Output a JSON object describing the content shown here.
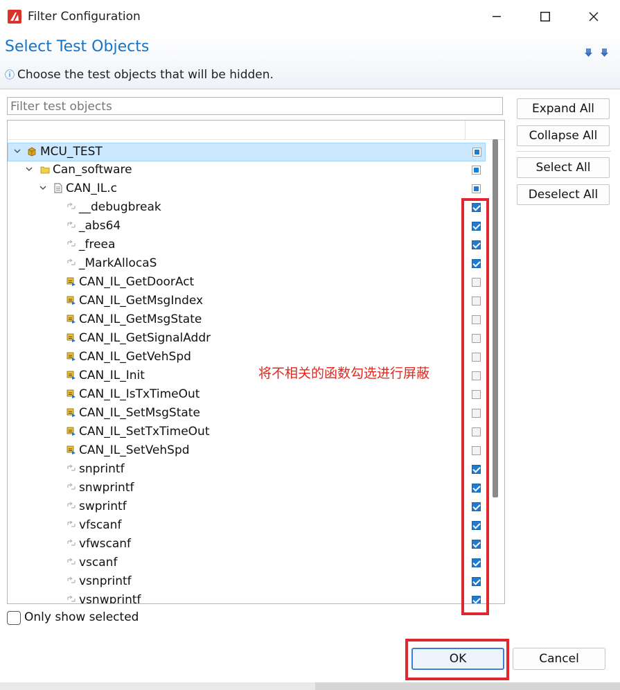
{
  "window": {
    "title": "Filter Configuration"
  },
  "header": {
    "title": "Select Test Objects",
    "info_symbol": "ⓘ",
    "description": "Choose the test objects that will be hidden."
  },
  "filter": {
    "placeholder": "Filter test objects"
  },
  "tree": [
    {
      "label": "MCU_TEST",
      "level": 0,
      "expandable": true,
      "icon": "project-icon",
      "state": "partial",
      "selected": true
    },
    {
      "label": "Can_software",
      "level": 1,
      "expandable": true,
      "icon": "folder-icon",
      "state": "partial"
    },
    {
      "label": "CAN_IL.c",
      "level": 2,
      "expandable": true,
      "icon": "file-icon",
      "state": "partial"
    },
    {
      "label": "__debugbreak",
      "level": 3,
      "icon": "external-function-icon",
      "state": "checked"
    },
    {
      "label": "_abs64",
      "level": 3,
      "icon": "external-function-icon",
      "state": "checked"
    },
    {
      "label": "_freea",
      "level": 3,
      "icon": "external-function-icon",
      "state": "checked"
    },
    {
      "label": "_MarkAllocaS",
      "level": 3,
      "icon": "external-function-icon",
      "state": "checked"
    },
    {
      "label": "CAN_IL_GetDoorAct",
      "level": 3,
      "icon": "function-icon",
      "state": "unchecked"
    },
    {
      "label": "CAN_IL_GetMsgIndex",
      "level": 3,
      "icon": "function-icon",
      "state": "unchecked"
    },
    {
      "label": "CAN_IL_GetMsgState",
      "level": 3,
      "icon": "function-icon",
      "state": "unchecked"
    },
    {
      "label": "CAN_IL_GetSignalAddr",
      "level": 3,
      "icon": "function-icon",
      "state": "unchecked"
    },
    {
      "label": "CAN_IL_GetVehSpd",
      "level": 3,
      "icon": "function-icon",
      "state": "unchecked"
    },
    {
      "label": "CAN_IL_Init",
      "level": 3,
      "icon": "function-icon",
      "state": "unchecked"
    },
    {
      "label": "CAN_IL_IsTxTimeOut",
      "level": 3,
      "icon": "function-icon",
      "state": "unchecked"
    },
    {
      "label": "CAN_IL_SetMsgState",
      "level": 3,
      "icon": "function-icon",
      "state": "unchecked"
    },
    {
      "label": "CAN_IL_SetTxTimeOut",
      "level": 3,
      "icon": "function-icon",
      "state": "unchecked"
    },
    {
      "label": "CAN_IL_SetVehSpd",
      "level": 3,
      "icon": "function-icon",
      "state": "unchecked"
    },
    {
      "label": "snprintf",
      "level": 3,
      "icon": "external-function-icon",
      "state": "checked"
    },
    {
      "label": "snwprintf",
      "level": 3,
      "icon": "external-function-icon",
      "state": "checked"
    },
    {
      "label": "swprintf",
      "level": 3,
      "icon": "external-function-icon",
      "state": "checked"
    },
    {
      "label": "vfscanf",
      "level": 3,
      "icon": "external-function-icon",
      "state": "checked"
    },
    {
      "label": "vfwscanf",
      "level": 3,
      "icon": "external-function-icon",
      "state": "checked"
    },
    {
      "label": "vscanf",
      "level": 3,
      "icon": "external-function-icon",
      "state": "checked"
    },
    {
      "label": "vsnprintf",
      "level": 3,
      "icon": "external-function-icon",
      "state": "checked"
    },
    {
      "label": "vsnwprintf",
      "level": 3,
      "icon": "external-function-icon",
      "state": "checked"
    }
  ],
  "buttons": {
    "expand_all": "Expand All",
    "collapse_all": "Collapse All",
    "select_all": "Select All",
    "deselect_all": "Deselect All",
    "ok": "OK",
    "cancel": "Cancel"
  },
  "only_show_selected": {
    "label": "Only show selected",
    "checked": false
  },
  "annotation": "将不相关的函数勾选进行屏蔽",
  "colors": {
    "accent": "#1574c6",
    "annotation_red": "#e3252f",
    "selection": "#cce8ff"
  }
}
